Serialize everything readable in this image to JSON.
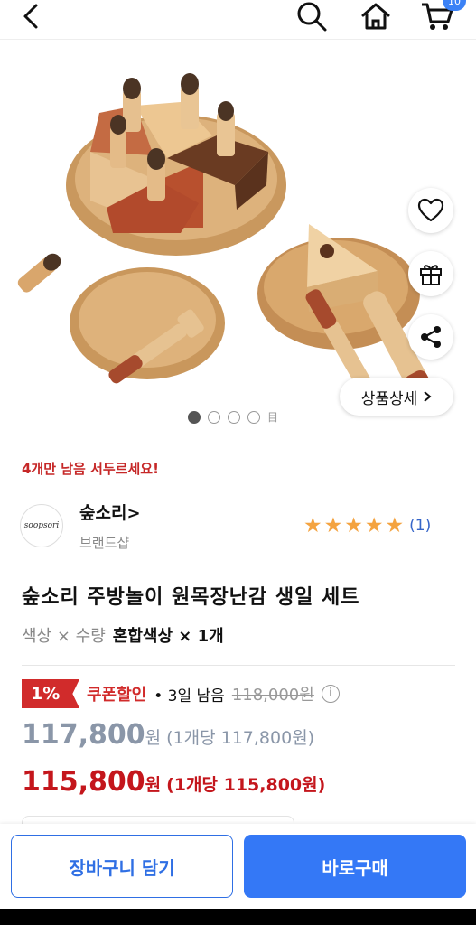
{
  "header": {
    "cart_badge": "10",
    "icons": [
      "back-arrow-icon",
      "search-icon",
      "home-icon",
      "cart-icon"
    ]
  },
  "gallery": {
    "detail_label": "상품상세",
    "pages_total": 4,
    "current_page": 1,
    "more_glyph": "目"
  },
  "stock_notice": "4개만 남음 서두르세요!",
  "brand": {
    "logo_text": "soopsori",
    "name": "숲소리",
    "subtitle": "브랜드샵",
    "rating_stars": 5,
    "rating_count": "(1)"
  },
  "product": {
    "title": "숲소리 주방놀이 원목장난감 생일 세트",
    "option_label": "색상 × 수량",
    "option_value": "혼합색상 × 1개"
  },
  "pricing": {
    "discount_pct": "1%",
    "coupon_label": "쿠폰할인",
    "days_left": "• 3일 남음",
    "original_price": "118,000원",
    "price": "117,800",
    "price_unit": "원",
    "price_per_unit": "(1개당 117,800원)",
    "final_price": "115,800",
    "final_price_unit": "원",
    "final_per_unit": "(1개당 115,800원)"
  },
  "actions": {
    "add_to_cart": "장바구니 담기",
    "buy_now": "바로구매"
  },
  "colors": {
    "accent_blue": "#3478f6",
    "sale_red": "#d12b2b",
    "star": "#f4a340"
  }
}
